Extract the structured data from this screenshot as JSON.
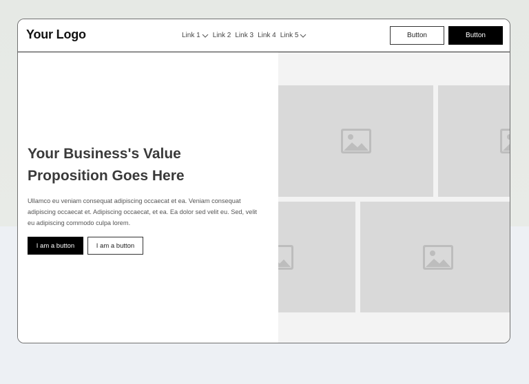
{
  "header": {
    "logo": "Your Logo",
    "nav": [
      {
        "label": "Link 1",
        "has_dropdown": true
      },
      {
        "label": "Link 2",
        "has_dropdown": false
      },
      {
        "label": "Link 3",
        "has_dropdown": false
      },
      {
        "label": "Link 4",
        "has_dropdown": false
      },
      {
        "label": "Link 5",
        "has_dropdown": true
      }
    ],
    "button_outline": "Button",
    "button_solid": "Button"
  },
  "hero": {
    "title": "Your Business's Value Proposition Goes Here",
    "text": "Ullamco eu veniam consequat adipiscing occaecat et ea. Veniam consequat adipiscing occaecat et. Adipiscing occaecat, et ea. Ea dolor sed velit eu. Sed, velit eu adipiscing commodo culpa lorem.",
    "cta_primary": "I am a button",
    "cta_secondary": "I am a button"
  },
  "gallery": {
    "icon": "image-placeholder-icon",
    "tile_count": 4
  },
  "colors": {
    "accent": "#000000",
    "placeholder": "#d9d9d9",
    "panel": "#f3f3f3"
  }
}
